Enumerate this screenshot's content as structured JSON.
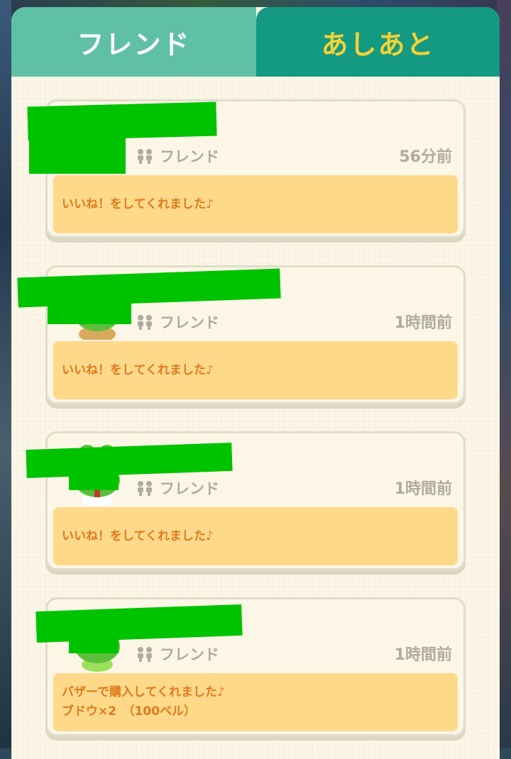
{
  "tabs": [
    {
      "label": "フレンド",
      "active": false
    },
    {
      "label": "あしあと",
      "active": true
    }
  ],
  "colors": {
    "tab_inactive": "#5fc0a6",
    "tab_active": "#149a80",
    "tab_active_text": "#f4d236",
    "message_bg": "#ffd98a",
    "message_text": "#e07a1c",
    "redaction": "#00c300"
  },
  "entries": [
    {
      "avatar": "redacted",
      "tag": "フレンド",
      "time": "56分前",
      "message_line1": "いいね！をしてくれました♪",
      "message_line2": ""
    },
    {
      "avatar": "frog-icon",
      "tag": "フレンド",
      "time": "1時間前",
      "message_line1": "いいね！をしてくれました♪",
      "message_line2": ""
    },
    {
      "avatar": "frog-icon",
      "tag": "フレンド",
      "time": "1時間前",
      "message_line1": "いいね！をしてくれました♪",
      "message_line2": ""
    },
    {
      "avatar": "frog-icon",
      "tag": "フレンド",
      "time": "1時間前",
      "message_line1": "バザーで購入してくれました♪",
      "message_line2": "ブドウ×2　（100ベル）"
    }
  ]
}
